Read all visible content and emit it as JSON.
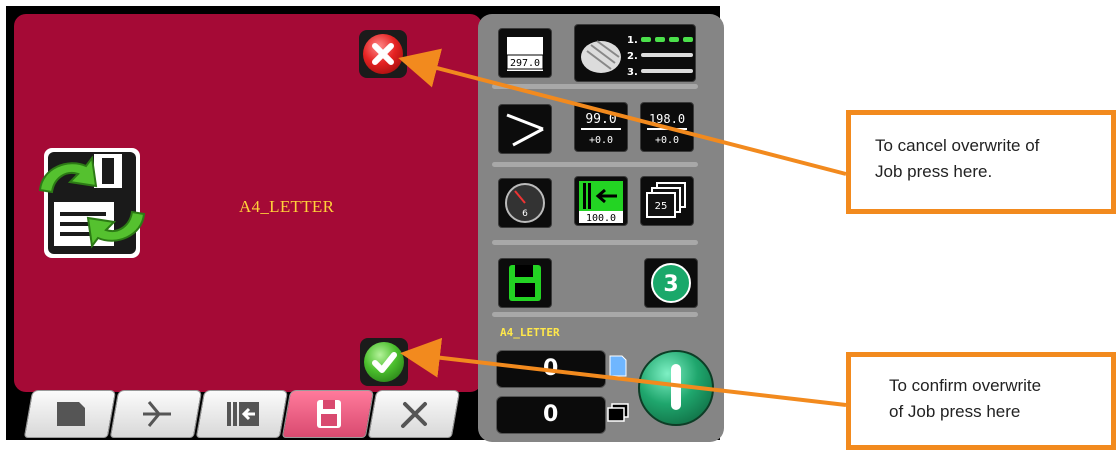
{
  "dialog": {
    "job_name": "A4_LETTER"
  },
  "panel": {
    "paper_length": "297.0",
    "trim_value": "99.0",
    "trim_offset": "+0.0",
    "cut_value": "198.0",
    "cut_offset": "+0.0",
    "gauge_value": "6",
    "stack_height": "100.0",
    "batch_count": "25",
    "program_number": "3",
    "job_label": "A4_LETTER",
    "sheet_counter": "0",
    "stack_counter": "0",
    "cut_list_marks": [
      "1.",
      "2.",
      "3."
    ]
  },
  "callouts": {
    "cancel_line1": "To cancel overwrite of",
    "cancel_line2": "Job press here.",
    "confirm_line1": "To confirm overwrite",
    "confirm_line2": "of Job press here"
  },
  "colors": {
    "dialog_bg": "#a50a36",
    "accent_orange": "#f28a1e",
    "job_text": "#ffd23a"
  }
}
